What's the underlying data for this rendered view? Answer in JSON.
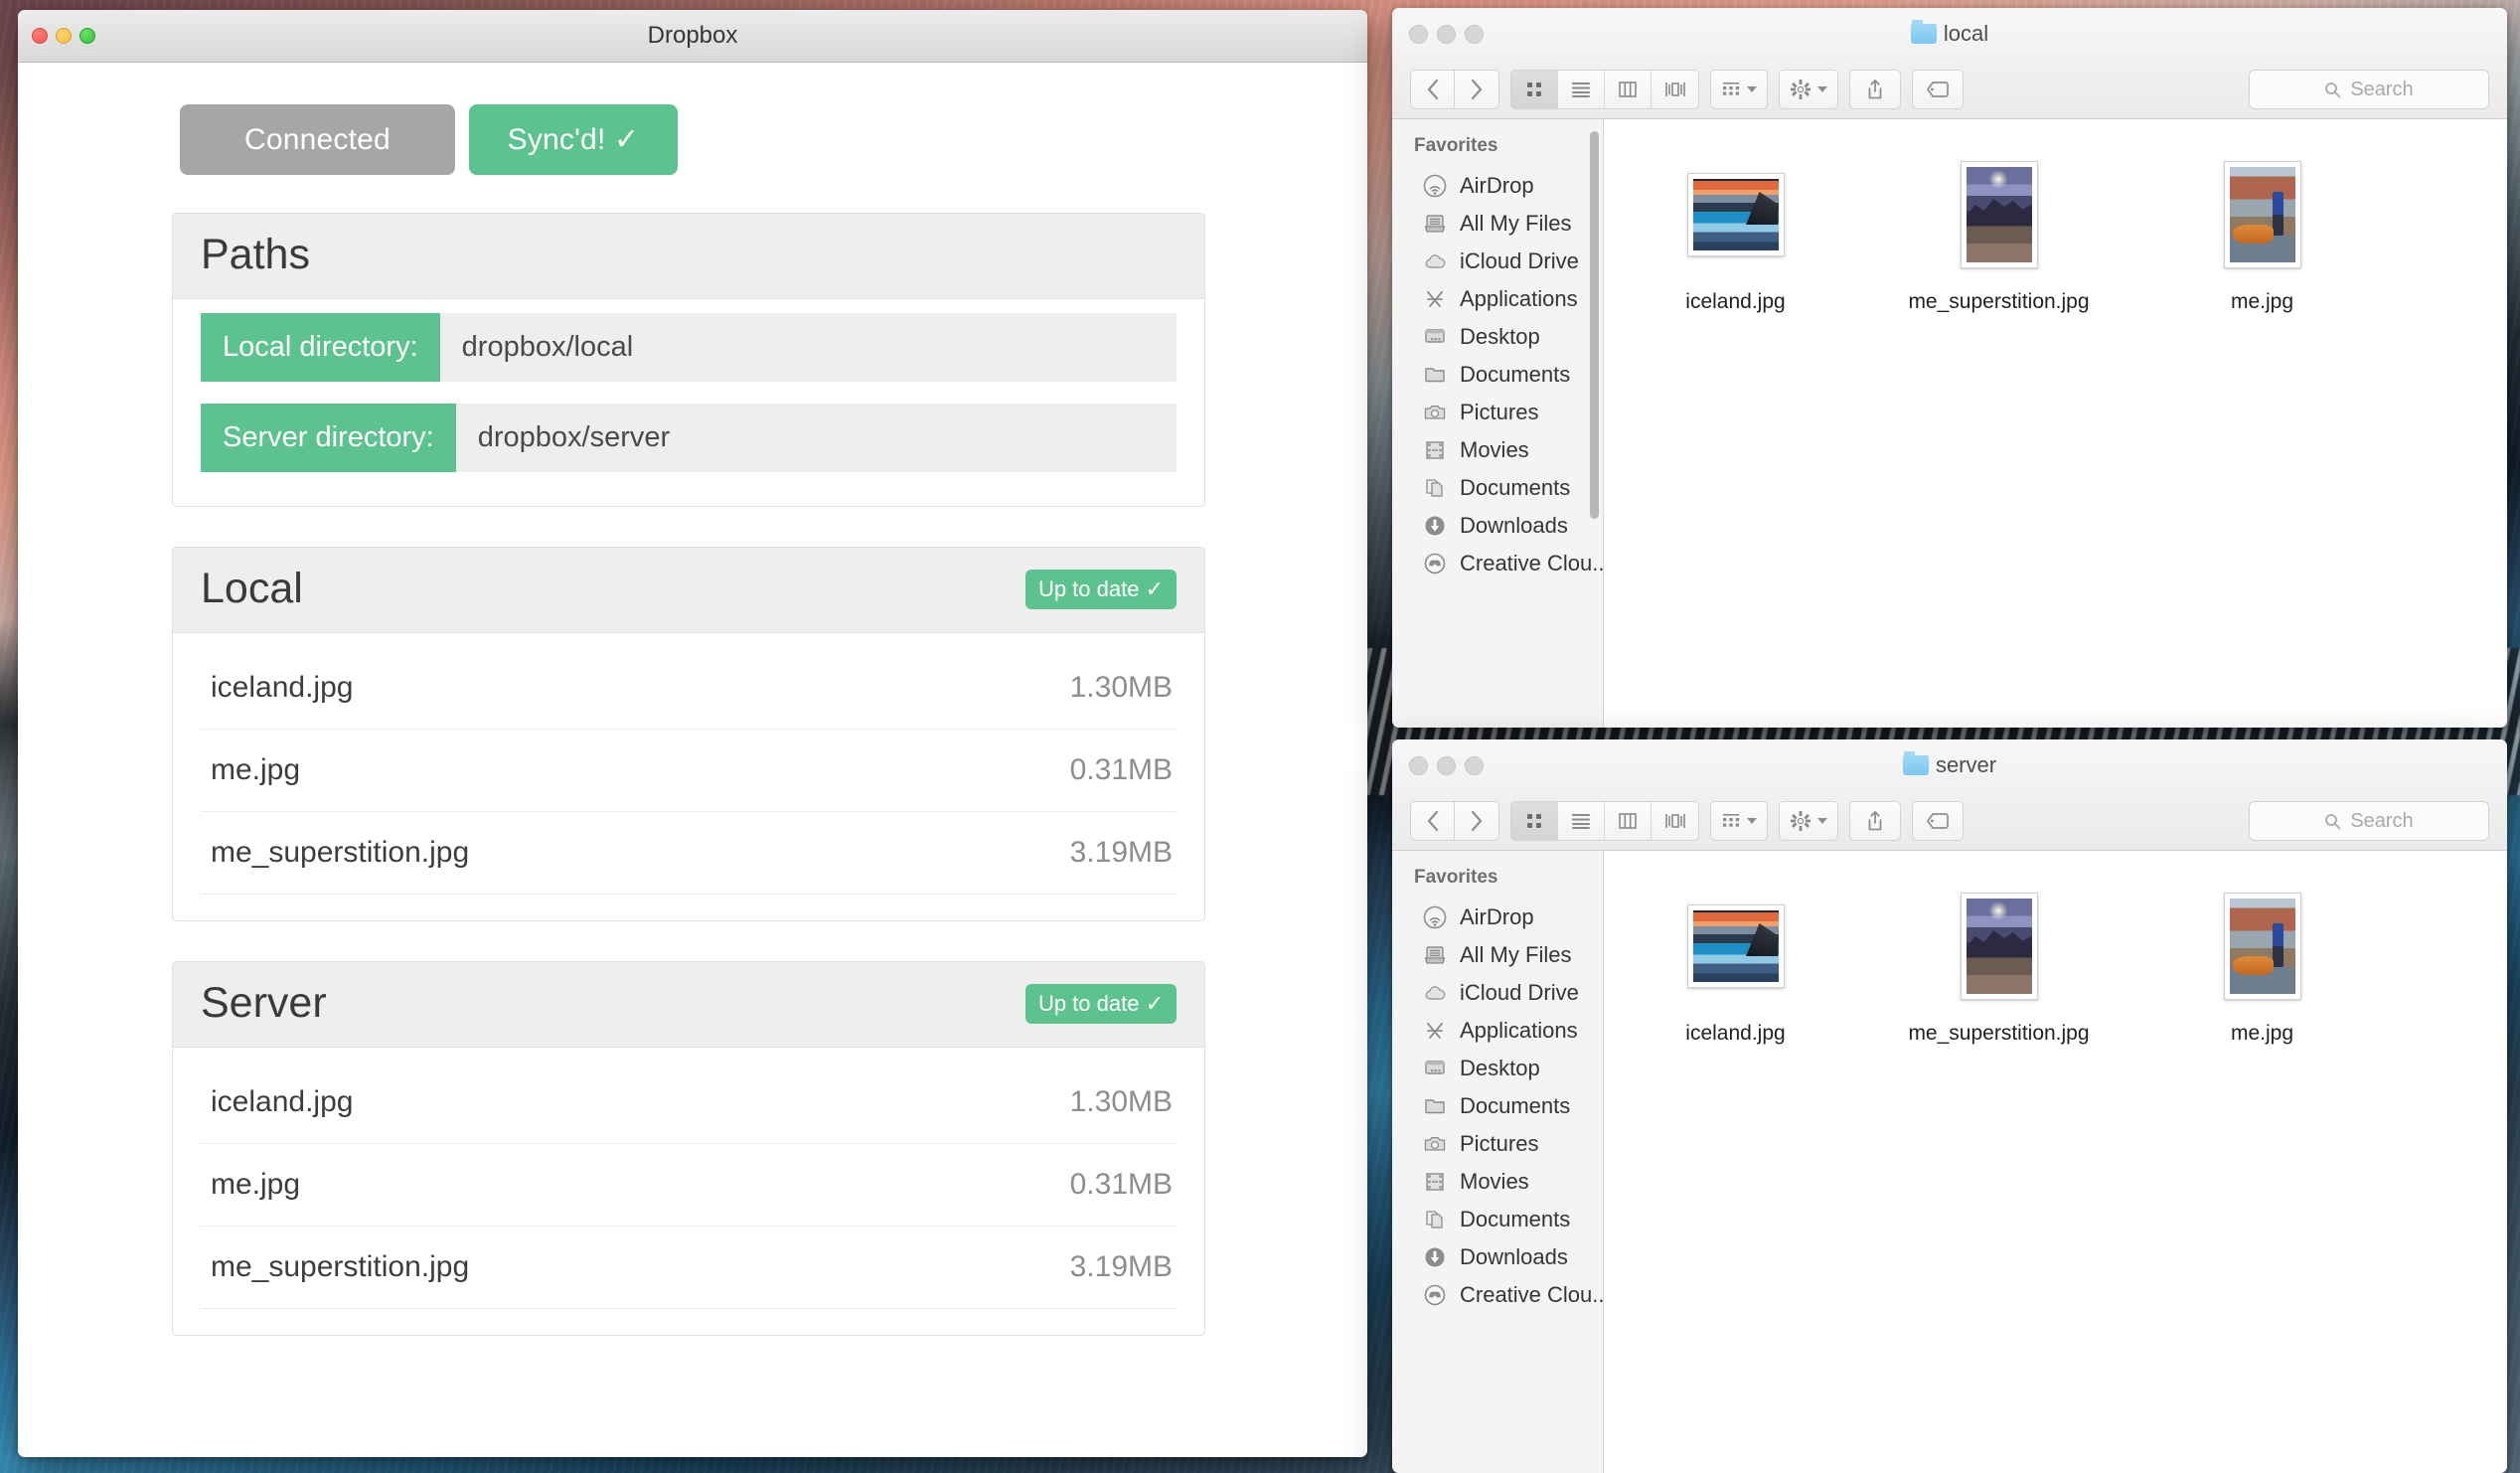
{
  "dropbox_app": {
    "window_title": "Dropbox",
    "traffic_lights": [
      "close",
      "minimize",
      "zoom"
    ],
    "buttons": {
      "connection_label": "Connected",
      "sync_label": "Sync'd! ✓"
    },
    "paths_panel": {
      "title": "Paths",
      "rows": [
        {
          "label": "Local directory:",
          "value": "dropbox/local"
        },
        {
          "label": "Server directory:",
          "value": "dropbox/server"
        }
      ]
    },
    "local_panel": {
      "title": "Local",
      "status_badge": "Up to date ✓",
      "files": [
        {
          "name": "iceland.jpg",
          "size": "1.30MB"
        },
        {
          "name": "me.jpg",
          "size": "0.31MB"
        },
        {
          "name": "me_superstition.jpg",
          "size": "3.19MB"
        }
      ]
    },
    "server_panel": {
      "title": "Server",
      "status_badge": "Up to date ✓",
      "files": [
        {
          "name": "iceland.jpg",
          "size": "1.30MB"
        },
        {
          "name": "me.jpg",
          "size": "0.31MB"
        },
        {
          "name": "me_superstition.jpg",
          "size": "3.19MB"
        }
      ]
    },
    "colors": {
      "accent_green": "#5cc38e",
      "neutral_grey": "#a6a6a6",
      "panel_header": "#eeeeee"
    }
  },
  "finder_local": {
    "window_title": "local",
    "toolbar": {
      "back_icon": "chevron-left-icon",
      "forward_icon": "chevron-right-icon",
      "view_icon_label": "icon-view-icon",
      "view_list_label": "list-view-icon",
      "view_column_label": "column-view-icon",
      "view_coverflow_label": "coverflow-view-icon",
      "arrange_icon": "arrange-icon",
      "action_icon": "gear-icon",
      "share_icon": "share-icon",
      "tag_icon": "tag-icon",
      "search_placeholder": "Search"
    },
    "sidebar": {
      "section_title": "Favorites",
      "items": [
        {
          "label": "AirDrop",
          "icon": "airdrop-icon"
        },
        {
          "label": "All My Files",
          "icon": "all-my-files-icon"
        },
        {
          "label": "iCloud Drive",
          "icon": "icloud-icon"
        },
        {
          "label": "Applications",
          "icon": "applications-icon"
        },
        {
          "label": "Desktop",
          "icon": "desktop-icon"
        },
        {
          "label": "Documents",
          "icon": "folder-icon"
        },
        {
          "label": "Pictures",
          "icon": "camera-icon"
        },
        {
          "label": "Movies",
          "icon": "film-icon"
        },
        {
          "label": "Documents",
          "icon": "documents-stack-icon"
        },
        {
          "label": "Downloads",
          "icon": "download-icon"
        },
        {
          "label": "Creative Clou...",
          "icon": "creative-cloud-icon"
        }
      ]
    },
    "files": [
      {
        "name": "iceland.jpg",
        "art": "art-iceland"
      },
      {
        "name": "me_superstition.jpg",
        "art": "art-superstition"
      },
      {
        "name": "me.jpg",
        "art": "art-me"
      }
    ]
  },
  "finder_server": {
    "window_title": "server",
    "toolbar": {
      "back_icon": "chevron-left-icon",
      "forward_icon": "chevron-right-icon",
      "search_placeholder": "Search"
    },
    "sidebar": {
      "section_title": "Favorites",
      "items": [
        {
          "label": "AirDrop",
          "icon": "airdrop-icon"
        },
        {
          "label": "All My Files",
          "icon": "all-my-files-icon"
        },
        {
          "label": "iCloud Drive",
          "icon": "icloud-icon"
        },
        {
          "label": "Applications",
          "icon": "applications-icon"
        },
        {
          "label": "Desktop",
          "icon": "desktop-icon"
        },
        {
          "label": "Documents",
          "icon": "folder-icon"
        },
        {
          "label": "Pictures",
          "icon": "camera-icon"
        },
        {
          "label": "Movies",
          "icon": "film-icon"
        },
        {
          "label": "Documents",
          "icon": "documents-stack-icon"
        },
        {
          "label": "Downloads",
          "icon": "download-icon"
        },
        {
          "label": "Creative Clou...",
          "icon": "creative-cloud-icon"
        }
      ]
    },
    "files": [
      {
        "name": "iceland.jpg",
        "art": "art-iceland"
      },
      {
        "name": "me_superstition.jpg",
        "art": "art-superstition"
      },
      {
        "name": "me.jpg",
        "art": "art-me"
      }
    ]
  }
}
